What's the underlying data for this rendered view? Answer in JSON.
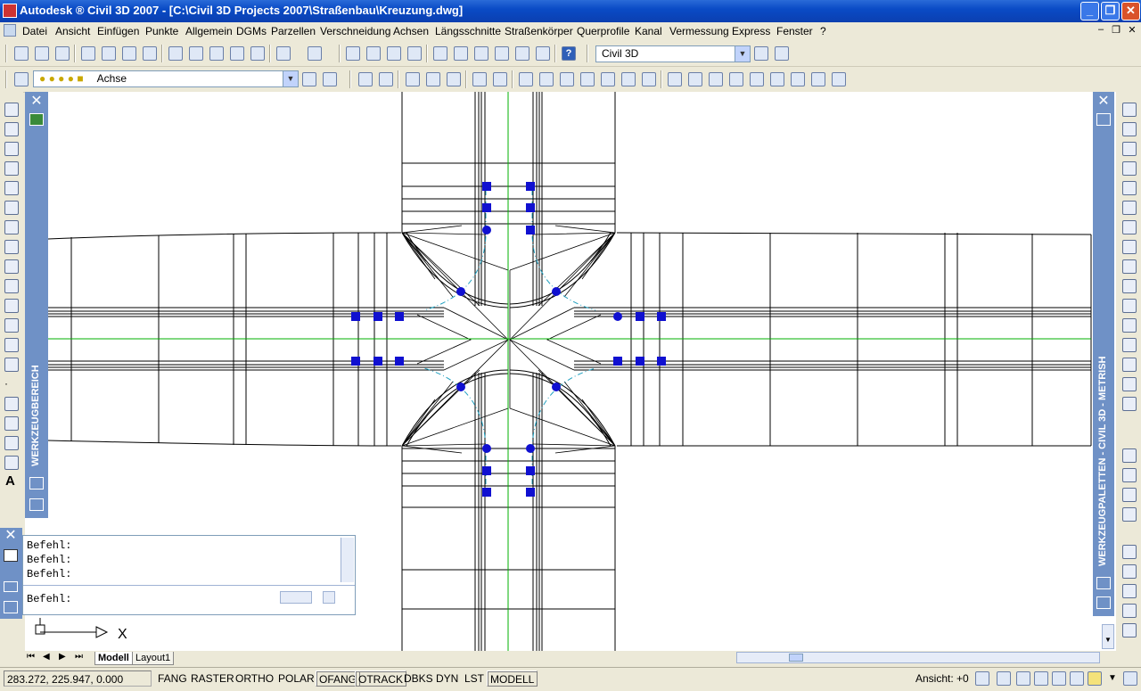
{
  "window": {
    "title": "Autodesk ® Civil 3D 2007 - [C:\\Civil 3D Projects 2007\\Straßenbau\\Kreuzung.dwg]",
    "min_glyph": "_",
    "max_glyph": "❐",
    "close_glyph": "✕"
  },
  "menu": {
    "items": [
      "Datei",
      "Ansicht",
      "Einfügen",
      "Punkte",
      "Allgemein",
      "DGMs",
      "Parzellen",
      "Verschneidung",
      "Achsen",
      "Längsschnitte",
      "Straßenkörper",
      "Querprofile",
      "Kanal",
      "Vermessung",
      "Express",
      "Fenster",
      "?"
    ],
    "doc_min": "–",
    "doc_restore": "❐",
    "doc_close": "✕"
  },
  "toolbar1": {
    "workspace_combo": "Civil 3D"
  },
  "toolbar2": {
    "layer_combo": "Achse"
  },
  "left_tools": {
    "text_tool": "A"
  },
  "tool_area": {
    "label": "WERKZEUGBEREICH",
    "close_glyph": "✕"
  },
  "tool_palettes": {
    "label": "WERKZEUGPALETTEN - CIVIL 3D - METRISH",
    "close_glyph": "✕"
  },
  "command_window": {
    "history": [
      "Befehl:",
      "Befehl:",
      "Befehl:"
    ],
    "prompt": "Befehl:",
    "close_glyph": "✕"
  },
  "tabs": {
    "model": "Modell",
    "layout1": "Layout1",
    "nav_first": "⏮",
    "nav_prev": "◀",
    "nav_next": "▶",
    "nav_last": "⏭"
  },
  "ucs_icon": {
    "x_label": "X"
  },
  "status_bar": {
    "coordinates": "283.272, 225.947, 0.000",
    "toggles": [
      "FANG",
      "RASTER",
      "ORTHO",
      "POLAR",
      "OFANG",
      "OTRACK",
      "DBKS",
      "DYN",
      "LST",
      "MODELL"
    ],
    "active_toggles": [
      "OFANG",
      "OTRACK",
      "MODELL"
    ],
    "view_label": "Ansicht:",
    "view_value": "+0"
  },
  "colors": {
    "titlebar": "#0a4bc6",
    "palette": "#6f91c6",
    "grip": "#1010d0",
    "alignment": "#00b000",
    "offset": "#20a0c0"
  }
}
